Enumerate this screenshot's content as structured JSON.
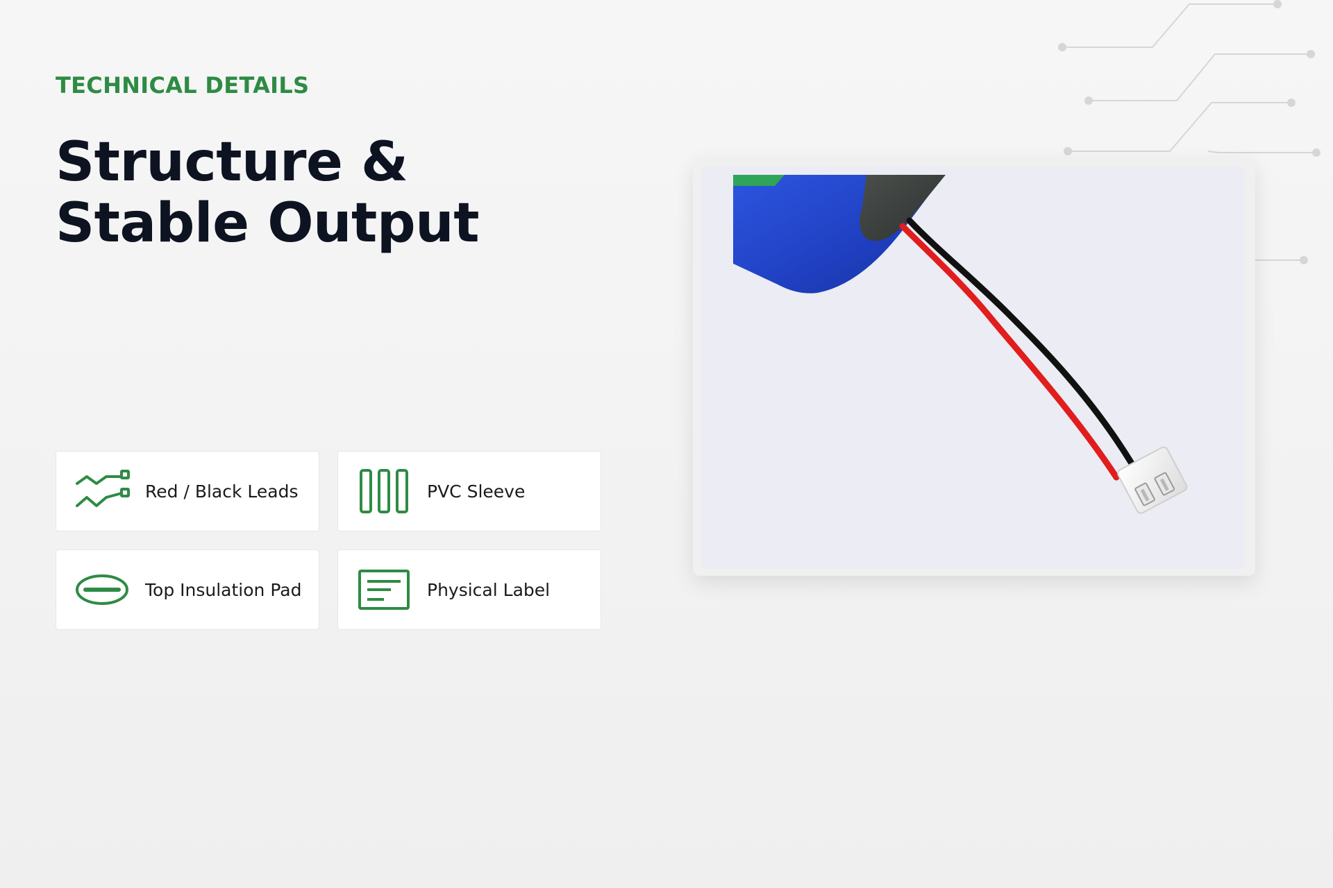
{
  "section": {
    "eyebrow": "TECHNICAL DETAILS",
    "title_line1": "Structure &",
    "title_line2": "Stable Output"
  },
  "features": [
    {
      "label": "Red / Black Leads",
      "icon": "wire-leads-icon"
    },
    {
      "label": "PVC Sleeve",
      "icon": "sleeve-icon"
    },
    {
      "label": "Top Insulation Pad",
      "icon": "insulation-pad-icon"
    },
    {
      "label": "Physical Label",
      "icon": "label-icon"
    }
  ],
  "colors": {
    "accent": "#2e8b44",
    "heading": "#0d1321",
    "card_bg": "#ffffff",
    "photo_bg": "#ebecf4",
    "battery_blue": "#2447c9",
    "lead_red": "#e11d1d",
    "lead_black": "#111111"
  }
}
